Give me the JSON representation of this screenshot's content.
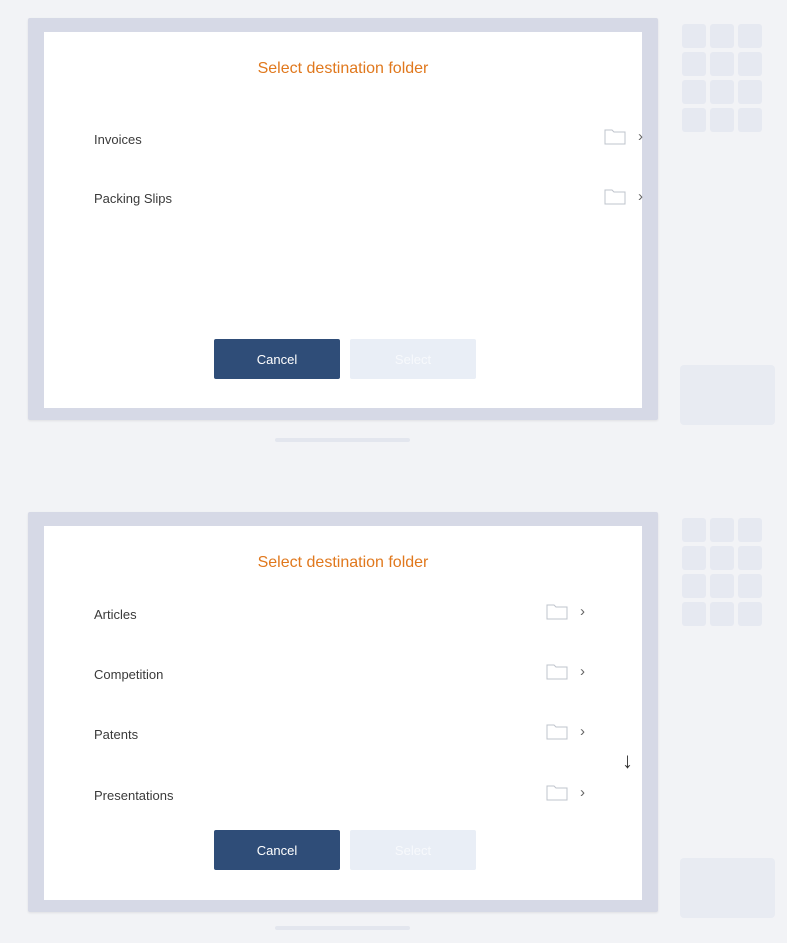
{
  "dialogs": [
    {
      "title": "Select destination folder",
      "folders": [
        {
          "label": "Invoices",
          "icon": "folder-icon"
        },
        {
          "label": "Packing Slips",
          "icon": "folder-icon"
        }
      ],
      "cancel_label": "Cancel",
      "select_label": "Select"
    },
    {
      "title": "Select destination folder",
      "folders": [
        {
          "label": "Articles",
          "icon": "folder-icon"
        },
        {
          "label": "Competition",
          "icon": "folder-icon"
        },
        {
          "label": "Patents",
          "icon": "folder-icon"
        },
        {
          "label": "Presentations",
          "icon": "folder-icon"
        }
      ],
      "cancel_label": "Cancel",
      "select_label": "Select",
      "scroll_indicator": "↓"
    }
  ],
  "colors": {
    "title": "#e0781d",
    "primary_button": "#2f4d78",
    "disabled_button": "#e9eef6",
    "frame": "#d6d9e6"
  }
}
